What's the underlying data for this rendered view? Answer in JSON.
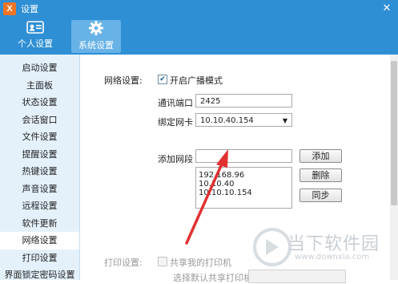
{
  "window": {
    "title": "设置",
    "logo_letter": "X",
    "close_glyph": "✕"
  },
  "toolbar": {
    "items": [
      {
        "label": "个人设置",
        "icon": "id-card-icon"
      },
      {
        "label": "系统设置",
        "icon": "gear-icon",
        "active": true
      }
    ]
  },
  "sidebar": {
    "items": [
      {
        "label": "启动设置"
      },
      {
        "label": "主面板"
      },
      {
        "label": "状态设置"
      },
      {
        "label": "会话窗口"
      },
      {
        "label": "文件设置"
      },
      {
        "label": "提醒设置"
      },
      {
        "label": "热键设置"
      },
      {
        "label": "声音设置"
      },
      {
        "label": "远程设置"
      },
      {
        "label": "软件更新"
      },
      {
        "label": "网络设置",
        "active": true
      },
      {
        "label": "打印设置"
      },
      {
        "label": "界面锁定密码设置"
      }
    ]
  },
  "network": {
    "section_label": "网络设置:",
    "broadcast_label": "开启广播模式",
    "broadcast_checked": true,
    "port_label": "通讯端口",
    "port_value": "2425",
    "nic_label": "绑定网卡",
    "nic_value": "10.10.40.154",
    "segment_label": "添加网段",
    "segment_value": "",
    "segments": [
      "192.168.96",
      "10.10.40",
      "10.10.10.154"
    ],
    "buttons": {
      "add": "添加",
      "delete": "删除",
      "sync": "同步"
    }
  },
  "print": {
    "section_label": "打印设置:",
    "share_label": "共享我的打印机",
    "share_checked": false,
    "default_label": "选择默认共享打印机"
  },
  "watermark": {
    "text": "当下软件园",
    "url": "www.downxia.com"
  },
  "colors": {
    "accent": "#2f8fd5",
    "sidebar_bg": "#e4f1fb",
    "arrow": "#e03131"
  }
}
